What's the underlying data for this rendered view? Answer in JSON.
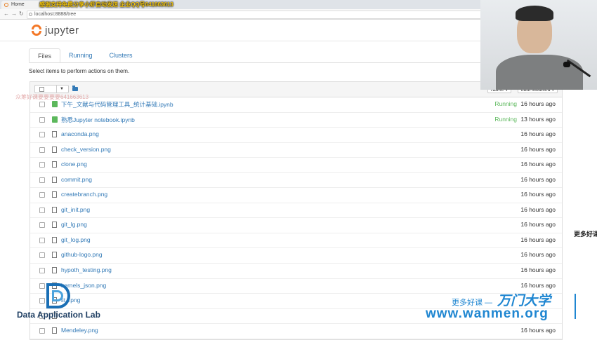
{
  "browser": {
    "tab_title": "Home",
    "url": "localhost:8888/tree",
    "overlay_banner": "感谢支持免费分享小虾自动发送 企业QQ号641663613"
  },
  "jupyter": {
    "logo_text": "jupyter",
    "tabs": [
      "Files",
      "Running",
      "Clusters"
    ],
    "active_tab": "Files",
    "instructions": "Select items to perform actions on them.",
    "sort_name": "Name ▾",
    "sort_modified": "Last Modified ▾",
    "files": [
      {
        "name": "下午_文献与代码管理工具_统计基础.ipynb",
        "type": "notebook",
        "running": "Running",
        "modified": "16 hours ago"
      },
      {
        "name": "熟悉Jupyter notebook.ipynb",
        "type": "notebook",
        "running": "Running",
        "modified": "13 hours ago"
      },
      {
        "name": "anaconda.png",
        "type": "file",
        "running": "",
        "modified": "16 hours ago"
      },
      {
        "name": "check_version.png",
        "type": "file",
        "running": "",
        "modified": "16 hours ago"
      },
      {
        "name": "clone.png",
        "type": "file",
        "running": "",
        "modified": "16 hours ago"
      },
      {
        "name": "commit.png",
        "type": "file",
        "running": "",
        "modified": "16 hours ago"
      },
      {
        "name": "createbranch.png",
        "type": "file",
        "running": "",
        "modified": "16 hours ago"
      },
      {
        "name": "git_init.png",
        "type": "file",
        "running": "",
        "modified": "16 hours ago"
      },
      {
        "name": "git_lg.png",
        "type": "file",
        "running": "",
        "modified": "16 hours ago"
      },
      {
        "name": "git_log.png",
        "type": "file",
        "running": "",
        "modified": "16 hours ago"
      },
      {
        "name": "github-logo.png",
        "type": "file",
        "running": "",
        "modified": "16 hours ago"
      },
      {
        "name": "hypoth_testing.png",
        "type": "file",
        "running": "",
        "modified": "16 hours ago"
      },
      {
        "name": "kernels_json.png",
        "type": "file",
        "running": "",
        "modified": "16 hours ago"
      },
      {
        "name": "lit...png",
        "type": "file",
        "running": "",
        "modified": ""
      },
      {
        "name": "",
        "type": "file",
        "running": "",
        "modified": ""
      },
      {
        "name": "Mendeley.png",
        "type": "file",
        "running": "",
        "modified": "16 hours ago"
      }
    ]
  },
  "watermarks": {
    "overlay_mid": "众筹好课要要要要641663613",
    "dal_text": "Data Application Lab",
    "more_courses": "更多好课 —",
    "brand": "万门大学",
    "site_url": "www.wanmen.org",
    "right_text": "更多好课"
  },
  "colors": {
    "jupyter_orange": "#f37726",
    "link_blue": "#337ab7",
    "running_green": "#5cb85c",
    "wanmen_blue": "#1f86d1"
  }
}
